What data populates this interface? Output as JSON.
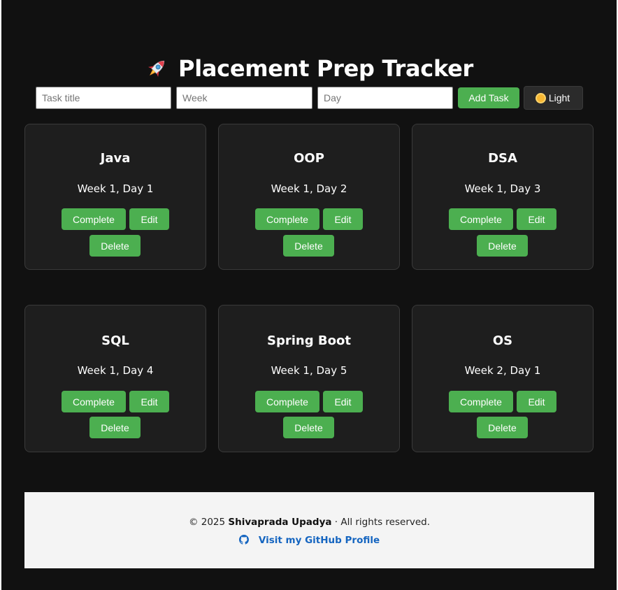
{
  "app": {
    "title": "Placement Prep Tracker",
    "title_icon": "rocket-icon"
  },
  "toolbar": {
    "task_title_placeholder": "Task title",
    "week_placeholder": "Week",
    "day_placeholder": "Day",
    "task_title_value": "",
    "week_value": "",
    "day_value": "",
    "add_label": "Add Task",
    "theme_icon": "sun-icon",
    "theme_label": "Light"
  },
  "tasks": [
    {
      "title": "Java",
      "schedule": "Week 1, Day 1",
      "complete_label": "Complete",
      "edit_label": "Edit",
      "delete_label": "Delete"
    },
    {
      "title": "OOP",
      "schedule": "Week 1, Day 2",
      "complete_label": "Complete",
      "edit_label": "Edit",
      "delete_label": "Delete"
    },
    {
      "title": "DSA",
      "schedule": "Week 1, Day 3",
      "complete_label": "Complete",
      "edit_label": "Edit",
      "delete_label": "Delete"
    },
    {
      "title": "SQL",
      "schedule": "Week 1, Day 4",
      "complete_label": "Complete",
      "edit_label": "Edit",
      "delete_label": "Delete"
    },
    {
      "title": "Spring Boot",
      "schedule": "Week 1, Day 5",
      "complete_label": "Complete",
      "edit_label": "Edit",
      "delete_label": "Delete"
    },
    {
      "title": "OS",
      "schedule": "Week 2, Day 1",
      "complete_label": "Complete",
      "edit_label": "Edit",
      "delete_label": "Delete"
    }
  ],
  "footer": {
    "copyright_prefix": "© 2025 ",
    "author": "Shivaprada Upadya",
    "copyright_suffix": " · All rights reserved.",
    "github_icon": "github-icon",
    "github_link_label": "Visit my GitHub Profile"
  },
  "colors": {
    "background": "#111111",
    "card": "#1e1e1e",
    "accent_green": "#4caf50",
    "footer_bg": "#f4f4f4",
    "link": "#1565c0"
  }
}
